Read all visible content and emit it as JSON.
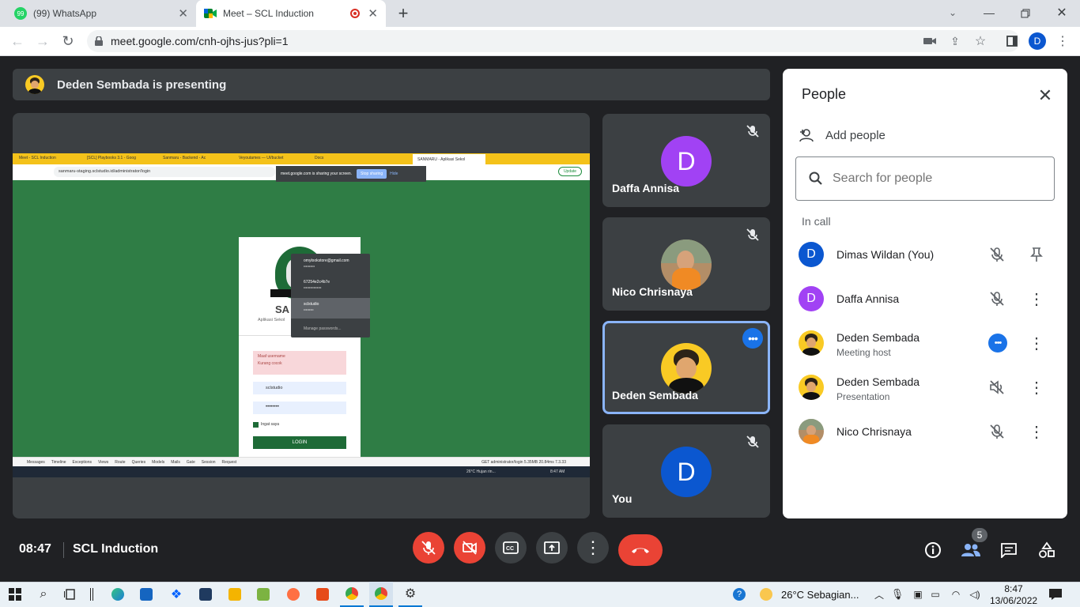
{
  "browser": {
    "tabs": [
      {
        "title": "(99) WhatsApp",
        "badge": "99"
      },
      {
        "title": "Meet – SCL Induction"
      }
    ],
    "url": "meet.google.com/cnh-ojhs-jus?pli=1",
    "profile_initial": "D"
  },
  "meet": {
    "presenting_banner": "Deden Sembada is presenting",
    "shared_screen": {
      "tabs": [
        "Meet - SCL Induction",
        "[SCL] Playbooks 3.1 - Goog",
        "Sanmaru - Backend - Ac",
        "Veyoutames — UI/bucket",
        "Docs",
        "SANMARU - Aplikasi Sekol"
      ],
      "url": "sanmaru-staging.sclstudio.id/administrator/login",
      "share_notice": "meet.google.com is sharing your screen.",
      "stop_sharing": "Stop sharing",
      "hide": "Hide",
      "update": "Update",
      "login_title": "SA",
      "login_subtitle": "Aplikasi Sekol",
      "error_lines": [
        "Maaf username",
        "Kurang cocok"
      ],
      "username": "sclstudio",
      "password_mask": "••••••••",
      "remember": "Ingat saya",
      "login_button": "LOGIN",
      "autofill": [
        {
          "user": "omylookstore@gmail.com",
          "pass": "••••••••••"
        },
        {
          "user": "67254e2c4b7e",
          "pass": "••••••••••••••••"
        },
        {
          "user": "sclstudio",
          "pass": "•••••••••"
        }
      ],
      "manage_passwords": "Manage passwords...",
      "debugbar": [
        "Messages",
        "Timeline",
        "Exceptions",
        "Views",
        "Route",
        "Queries",
        "Models",
        "Mails",
        "Gate",
        "Session",
        "Request"
      ],
      "debugbar_right": "GET administrator/login   5.35MB   20.84ms   7.3.33",
      "inner_weather": "26°C  Hujan rin...",
      "inner_time": "8:47 AM"
    },
    "tiles": [
      {
        "name": "Daffa Annisa",
        "initial": "D",
        "color": "#a142f4",
        "muted": true
      },
      {
        "name": "Nico Chrisnaya",
        "muted": true
      },
      {
        "name": "Deden Sembada",
        "muted": false,
        "active": true
      },
      {
        "name": "You",
        "initial": "D",
        "color": "#0b57d0",
        "muted": true
      }
    ],
    "people_panel": {
      "title": "People",
      "add_people": "Add people",
      "search_placeholder": "Search for people",
      "section": "In call",
      "participants": [
        {
          "name": "Dimas Wildan (You)",
          "initial": "D",
          "color": "#0b57d0",
          "sub": ""
        },
        {
          "name": "Daffa Annisa",
          "initial": "D",
          "color": "#a142f4",
          "sub": ""
        },
        {
          "name": "Deden Sembada",
          "sub": "Meeting host"
        },
        {
          "name": "Deden Sembada",
          "sub": "Presentation"
        },
        {
          "name": "Nico Chrisnaya",
          "sub": ""
        }
      ]
    },
    "bottom": {
      "time": "08:47",
      "meeting_title": "SCL Induction",
      "participant_count": "5"
    }
  },
  "taskbar": {
    "weather": "26°C  Sebagian...",
    "time": "8:47",
    "date": "13/06/2022"
  },
  "colors": {
    "meet_bg": "#202124",
    "tile_bg": "#3c4043",
    "red": "#ea4335",
    "blue": "#1a73e8"
  }
}
